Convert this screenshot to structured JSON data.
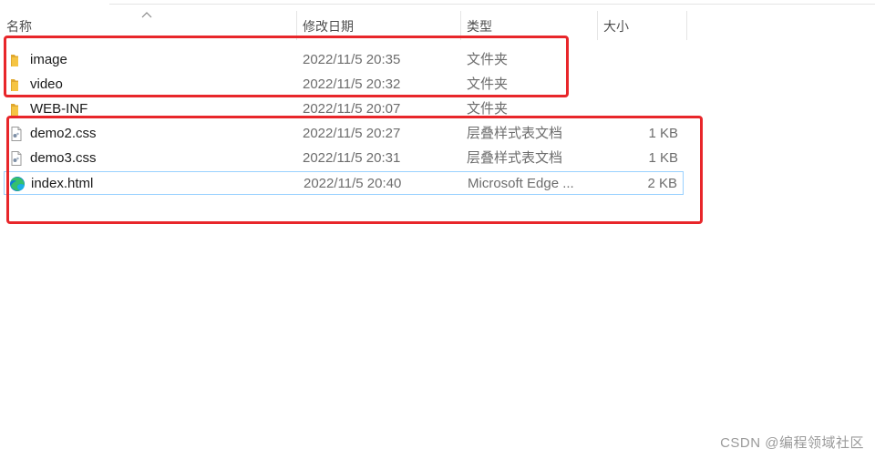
{
  "columns": {
    "name": "名称",
    "date": "修改日期",
    "type": "类型",
    "size": "大小"
  },
  "files": [
    {
      "name": "image",
      "date": "2022/11/5 20:35",
      "type": "文件夹",
      "size": "",
      "icon": "folder-icon"
    },
    {
      "name": "video",
      "date": "2022/11/5 20:32",
      "type": "文件夹",
      "size": "",
      "icon": "folder-icon"
    },
    {
      "name": "WEB-INF",
      "date": "2022/11/5 20:07",
      "type": "文件夹",
      "size": "",
      "icon": "folder-icon"
    },
    {
      "name": "demo2.css",
      "date": "2022/11/5 20:27",
      "type": "层叠样式表文档",
      "size": "1 KB",
      "icon": "css-file-icon"
    },
    {
      "name": "demo3.css",
      "date": "2022/11/5 20:31",
      "type": "层叠样式表文档",
      "size": "1 KB",
      "icon": "css-file-icon"
    },
    {
      "name": "index.html",
      "date": "2022/11/5 20:40",
      "type": "Microsoft Edge ...",
      "size": "2 KB",
      "icon": "edge-icon",
      "selected": true
    }
  ],
  "colors": {
    "highlight": "#e8262a",
    "selection_border": "#99d1ff",
    "folder": "#f5c443",
    "edge_blue": "#0c7bd6",
    "edge_green": "#35c06c"
  },
  "watermark": "CSDN @编程领域社区"
}
